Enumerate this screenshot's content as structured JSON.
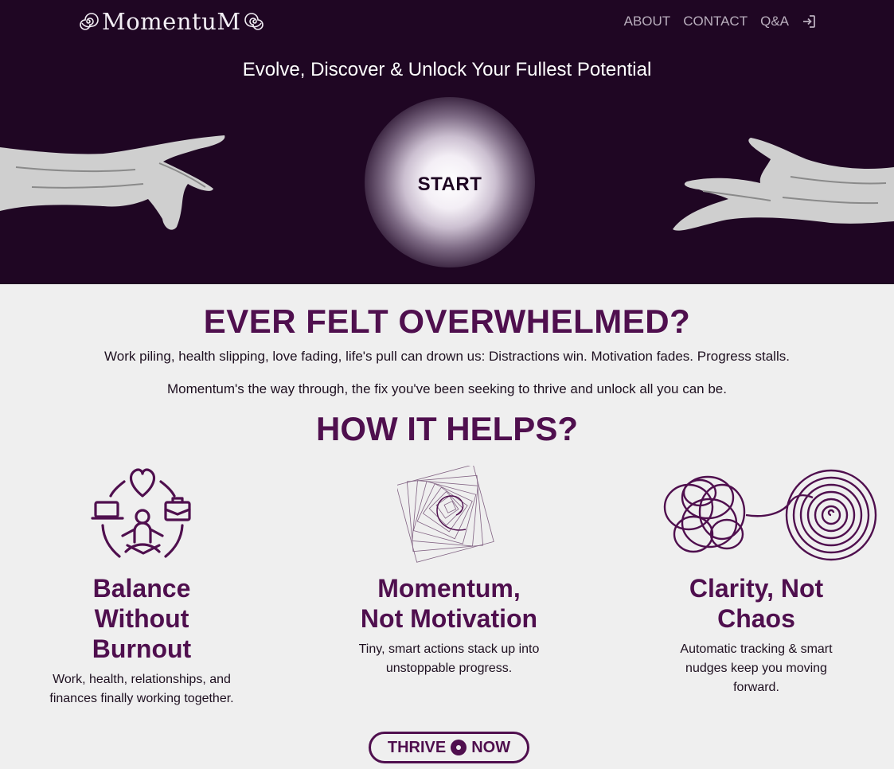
{
  "nav": {
    "logo": "MomentuM",
    "items": [
      {
        "label": "ABOUT"
      },
      {
        "label": "CONTACT"
      },
      {
        "label": "Q&A"
      }
    ],
    "login_icon": "login-icon"
  },
  "hero": {
    "tagline": "Evolve, Discover & Unlock Your Fullest Potential",
    "start_label": "START"
  },
  "intro": {
    "heading": "EVER FELT OVERWHELMED?",
    "line1": "Work piling, health slipping, love fading, life's pull can drown us: Distractions win. Motivation fades. Progress stalls.",
    "line2": "Momentum's the way through, the fix you've been seeking to thrive and unlock all you can be."
  },
  "helps": {
    "heading": "HOW IT HELPS?",
    "features": [
      {
        "title_l1": "Balance",
        "title_l2": "Without",
        "title_l3": "Burnout",
        "desc_l1": "Work, health, relationships, and",
        "desc_l2": "finances finally working together.",
        "icon": "meditation-balance-icon"
      },
      {
        "title_l1": "Momentum,",
        "title_l2": "Not Motivation",
        "desc_l1": "Tiny, smart actions stack up into",
        "desc_l2": "unstoppable progress.",
        "icon": "spiral-squares-icon"
      },
      {
        "title_l1": "Clarity, Not",
        "title_l2": "Chaos",
        "desc_l1": "Automatic tracking & smart",
        "desc_l2": "nudges keep you moving",
        "desc_l3": "forward.",
        "icon": "tangle-to-spiral-icon"
      }
    ]
  },
  "cta": {
    "label_left": "THRIVE",
    "label_right": "NOW"
  },
  "colors": {
    "hero_bg": "#1f0623",
    "accent": "#4f0f4e",
    "page_bg": "#efefef"
  }
}
